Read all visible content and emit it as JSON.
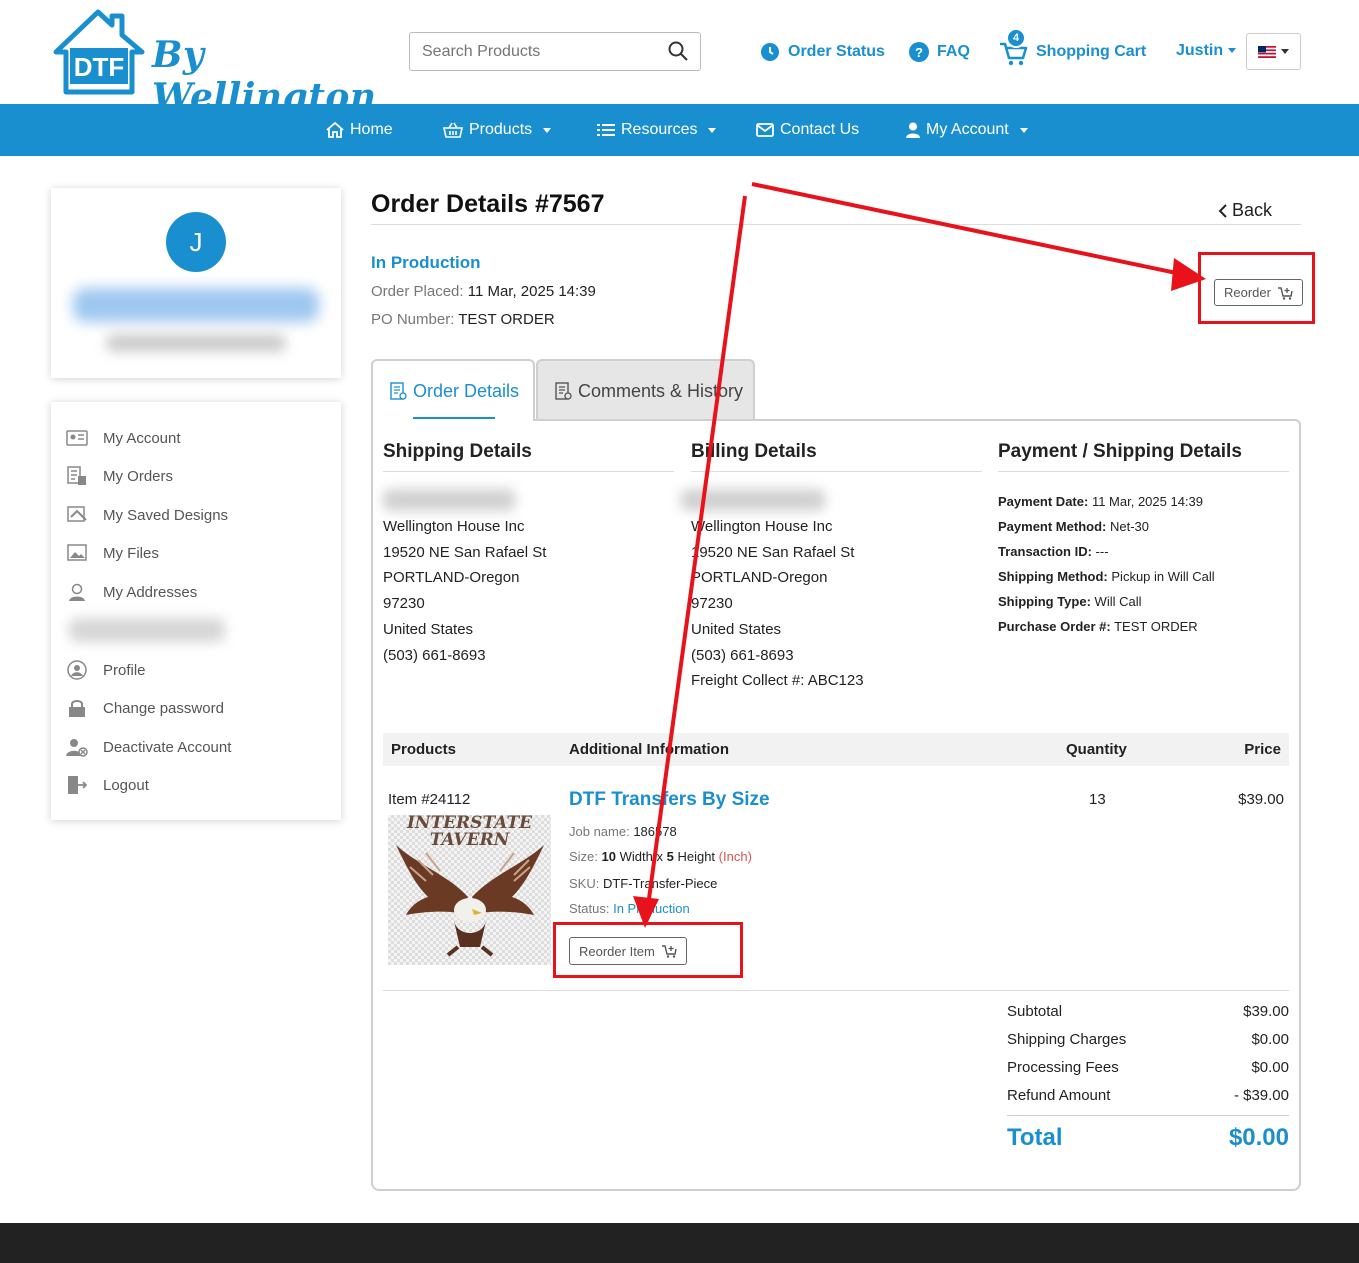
{
  "header": {
    "logo_text": "DTF",
    "logo_script": "By Wellington",
    "search_placeholder": "Search Products",
    "order_status": "Order Status",
    "faq": "FAQ",
    "cart_count": "4",
    "cart": "Shopping Cart",
    "user": "Justin"
  },
  "nav": {
    "home": "Home",
    "products": "Products",
    "resources": "Resources",
    "contact": "Contact Us",
    "account": "My Account"
  },
  "sidebar": {
    "avatar_initial": "J",
    "items": [
      "My Account",
      "My Orders",
      "My Saved Designs",
      "My Files",
      "My Addresses",
      "Profile",
      "Change password",
      "Deactivate Account",
      "Logout"
    ]
  },
  "order": {
    "title": "Order Details #7567",
    "back": "Back",
    "status": "In Production",
    "placed_label": "Order Placed:",
    "placed_value": "11 Mar, 2025 14:39",
    "po_label": "PO Number:",
    "po_value": "TEST ORDER",
    "reorder": "Reorder"
  },
  "tabs": {
    "details": "Order Details",
    "comments": "Comments & History"
  },
  "shipping": {
    "heading": "Shipping Details",
    "lines": [
      "Wellington House Inc",
      "19520 NE San Rafael St",
      "PORTLAND-Oregon",
      "97230",
      "United States",
      "(503) 661-8693"
    ]
  },
  "billing": {
    "heading": "Billing Details",
    "lines": [
      "Wellington House Inc",
      "19520 NE San Rafael St",
      "PORTLAND-Oregon",
      "97230",
      "United States",
      "(503) 661-8693",
      "Freight Collect #: ABC123"
    ]
  },
  "payment": {
    "heading": "Payment / Shipping Details",
    "rows": [
      {
        "label": "Payment Date:",
        "value": "11 Mar, 2025 14:39"
      },
      {
        "label": "Payment Method:",
        "value": "Net-30"
      },
      {
        "label": "Transaction ID:",
        "value": "---"
      },
      {
        "label": "Shipping Method:",
        "value": "Pickup in Will Call"
      },
      {
        "label": "Shipping Type:",
        "value": "Will Call"
      },
      {
        "label": "Purchase Order #:",
        "value": "TEST ORDER"
      }
    ]
  },
  "table": {
    "headers": [
      "Products",
      "Additional Information",
      "Quantity",
      "Price"
    ],
    "item": {
      "number": "Item #24112",
      "image_text_1": "INTERSTATE",
      "image_text_2": "TAVERN",
      "name": "DTF Transfers By Size",
      "job_label": "Job name:",
      "job_value": "186578",
      "size_label": "Size:",
      "size_w": "10",
      "size_w_label": "Width",
      "size_x": "x",
      "size_h": "5",
      "size_h_label": "Height",
      "size_unit": "(Inch)",
      "sku_label": "SKU:",
      "sku_value": "DTF-Transfer-Piece",
      "status_label": "Status:",
      "status_value": "In Production",
      "reorder_item": "Reorder Item",
      "quantity": "13",
      "price": "$39.00"
    }
  },
  "summary": {
    "rows": [
      {
        "label": "Subtotal",
        "value": "$39.00"
      },
      {
        "label": "Shipping Charges",
        "value": "$0.00"
      },
      {
        "label": "Processing Fees",
        "value": "$0.00"
      },
      {
        "label": "Refund Amount",
        "value": "- $39.00"
      }
    ],
    "total_label": "Total",
    "total_value": "$0.00"
  },
  "colors": {
    "brand": "#1a8fcf",
    "annotation": "#e8121b",
    "unit_red": "#d9534f"
  }
}
